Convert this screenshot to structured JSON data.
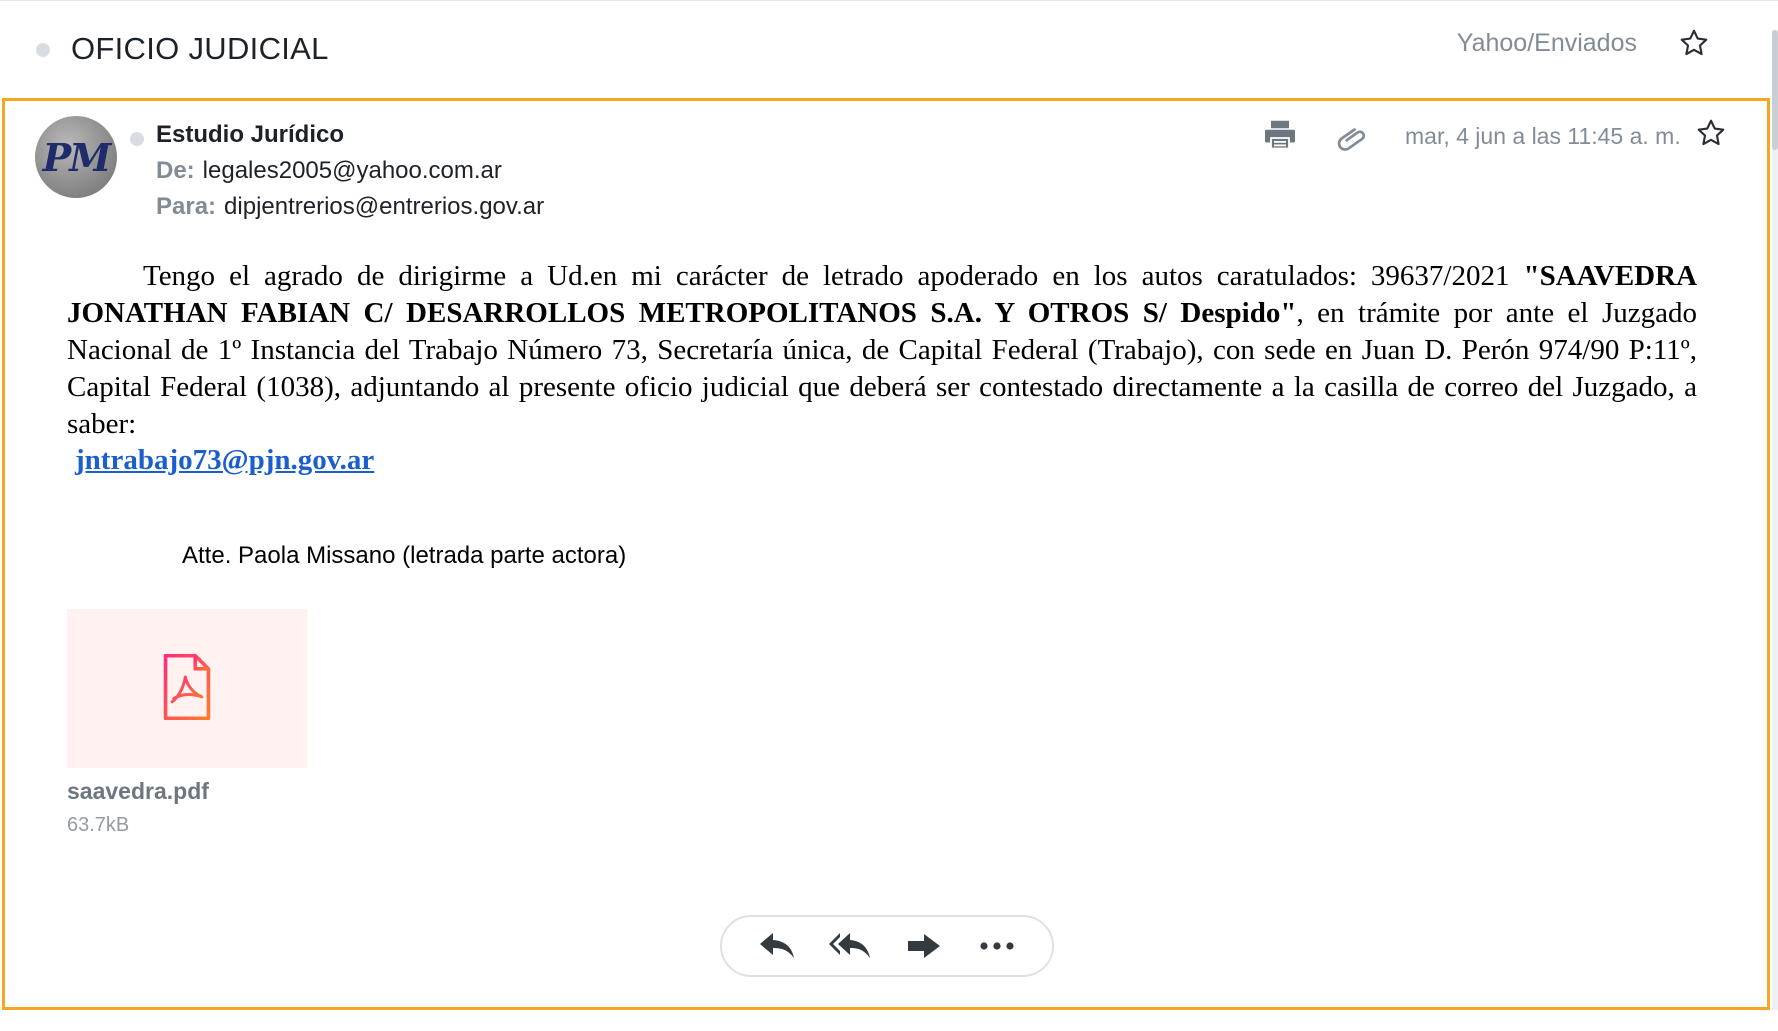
{
  "thread": {
    "title": "OFICIO JUDICIAL",
    "folder": "Yahoo/Enviados",
    "star_icon": "star-outline-icon"
  },
  "message": {
    "avatar_initials": "PM",
    "sender_name": "Estudio Jurídico",
    "from_label": "De:",
    "from_value": "legales2005@yahoo.com.ar",
    "to_label": "Para:",
    "to_value": "dipjentrerios@entrerios.gov.ar",
    "date": "mar, 4 jun a las 11:45 a. m.",
    "icons": [
      "print-icon",
      "attachment-icon",
      "star-outline-icon"
    ],
    "accent_color": "#f5a623"
  },
  "body": {
    "p1_start": "Tengo el agrado de dirigirme a Ud.en mi carácter de letrado apoderado en los autos caratulados: 39637/2021",
    "p1_bold": "\"SAAVEDRA JONATHAN FABIAN C/ DESARROLLOS METROPOLITANOS S.A. Y OTROS S/ Despido\"",
    "p1_rest": ", en trámite por ante el Juzgado Nacional de 1º Instancia del Trabajo Número 73, Secretaría única, de Capital Federal (Trabajo), con sede en Juan D. Perón 974/90 P:11º, Capital Federal (1038), adjuntando al presente oficio judicial que deberá ser contestado directamente a la casilla de correo del Juzgado, a saber:",
    "link": "jntrabajo73@pjn.gov.ar",
    "signature": "Atte. Paola Missano (letrada parte actora)"
  },
  "attachment": {
    "name": "saavedra.pdf",
    "size": "63.7kB",
    "icon": "pdf-icon"
  },
  "actions": [
    "reply-icon",
    "reply-all-icon",
    "forward-icon",
    "more-icon"
  ]
}
